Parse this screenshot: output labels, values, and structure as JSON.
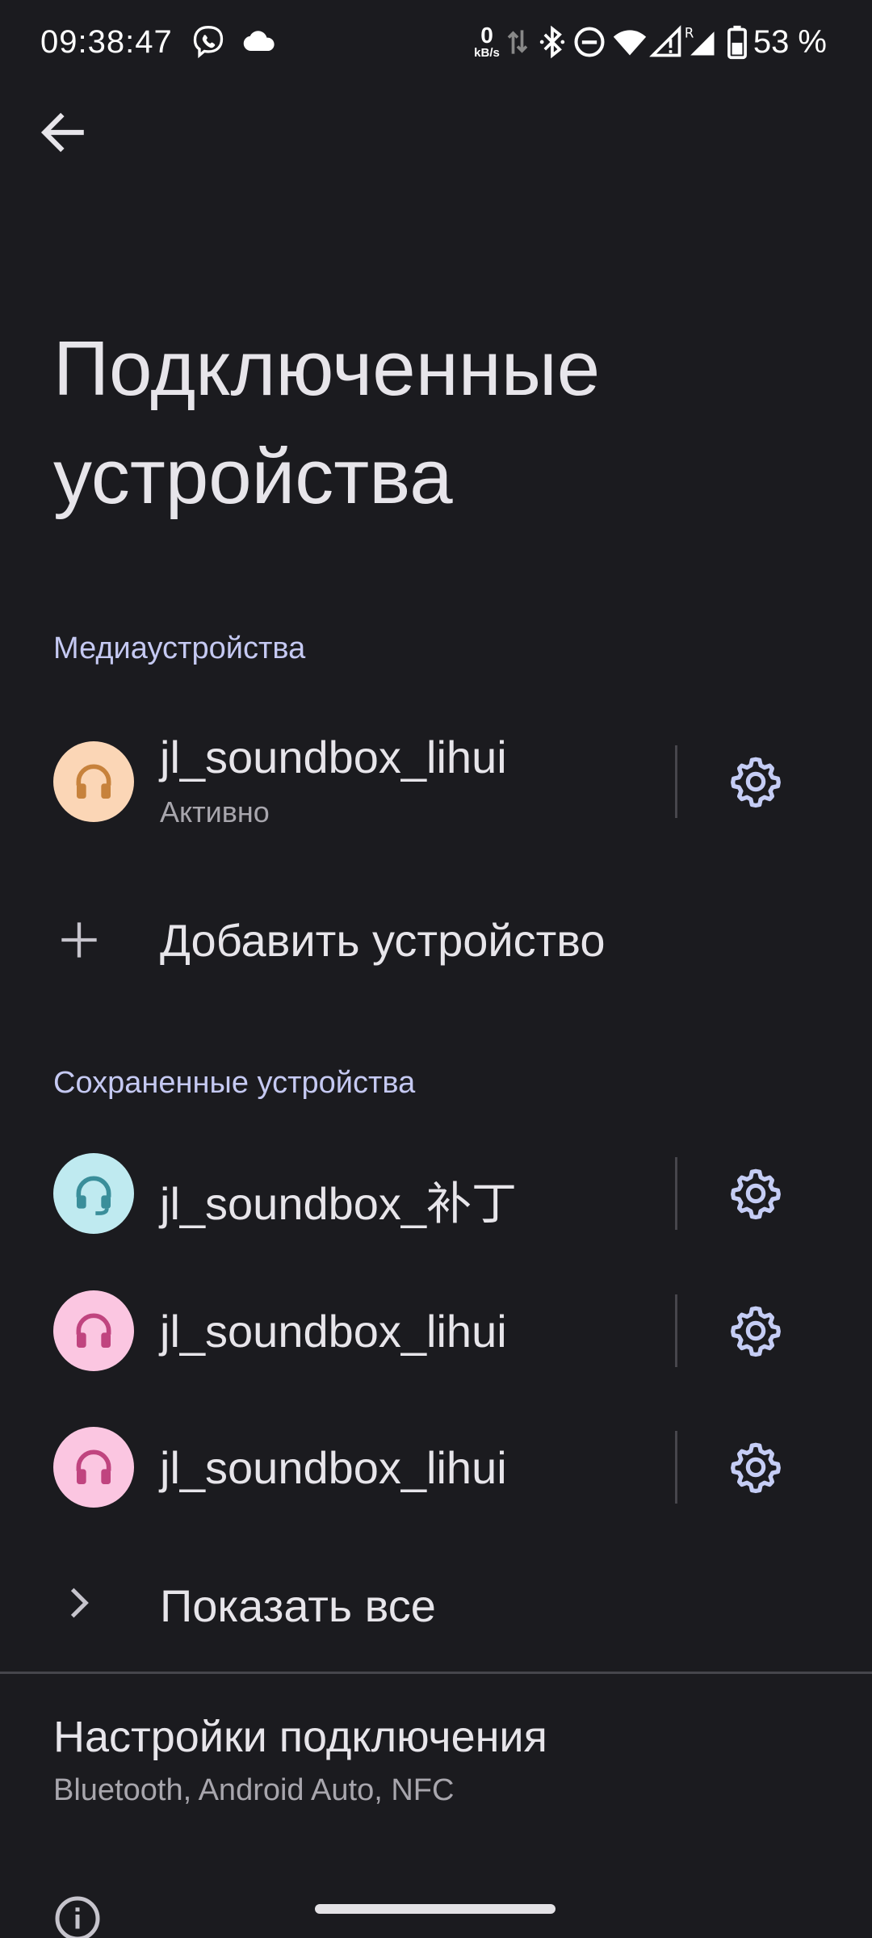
{
  "status_bar": {
    "time": "09:38:47",
    "net_speed_value": "0",
    "net_speed_unit": "kB/s",
    "battery_percent": "53 %",
    "icons": [
      "viber-icon",
      "cloud-icon",
      "data-arrows-icon",
      "bluetooth-icon",
      "dnd-icon",
      "wifi-icon",
      "signal-icon",
      "signal-roaming-icon",
      "battery-icon"
    ]
  },
  "header": {
    "title": "Подключенные устройства",
    "back_icon": "arrow-back-icon"
  },
  "media_section": {
    "title": "Медиаустройства",
    "devices": [
      {
        "name": "jl_soundbox_lihui",
        "status": "Активно",
        "icon": "headphones-icon",
        "avatar_color": "#fbd6b6",
        "icon_color": "#c7823c"
      }
    ]
  },
  "add_device": {
    "label": "Добавить устройство",
    "icon": "plus-icon"
  },
  "saved_section": {
    "title": "Сохраненные устройства",
    "devices": [
      {
        "name": "jl_soundbox_补丁",
        "icon": "headset-icon",
        "avatar_color": "#bfeaf0",
        "icon_color": "#3a8e9a"
      },
      {
        "name": "jl_soundbox_lihui",
        "icon": "headphones-icon",
        "avatar_color": "#fbc6e1",
        "icon_color": "#c0447f"
      },
      {
        "name": "jl_soundbox_lihui",
        "icon": "headphones-icon",
        "avatar_color": "#fbc6e1",
        "icon_color": "#c0447f"
      }
    ],
    "show_all": "Показать все"
  },
  "connection_settings": {
    "title": "Настройки подключения",
    "subtitle": "Bluetooth, Android Auto, NFC"
  },
  "colors": {
    "background": "#1b1b1f",
    "accent": "#c5c9f2",
    "gear": "#c5cdf5"
  }
}
